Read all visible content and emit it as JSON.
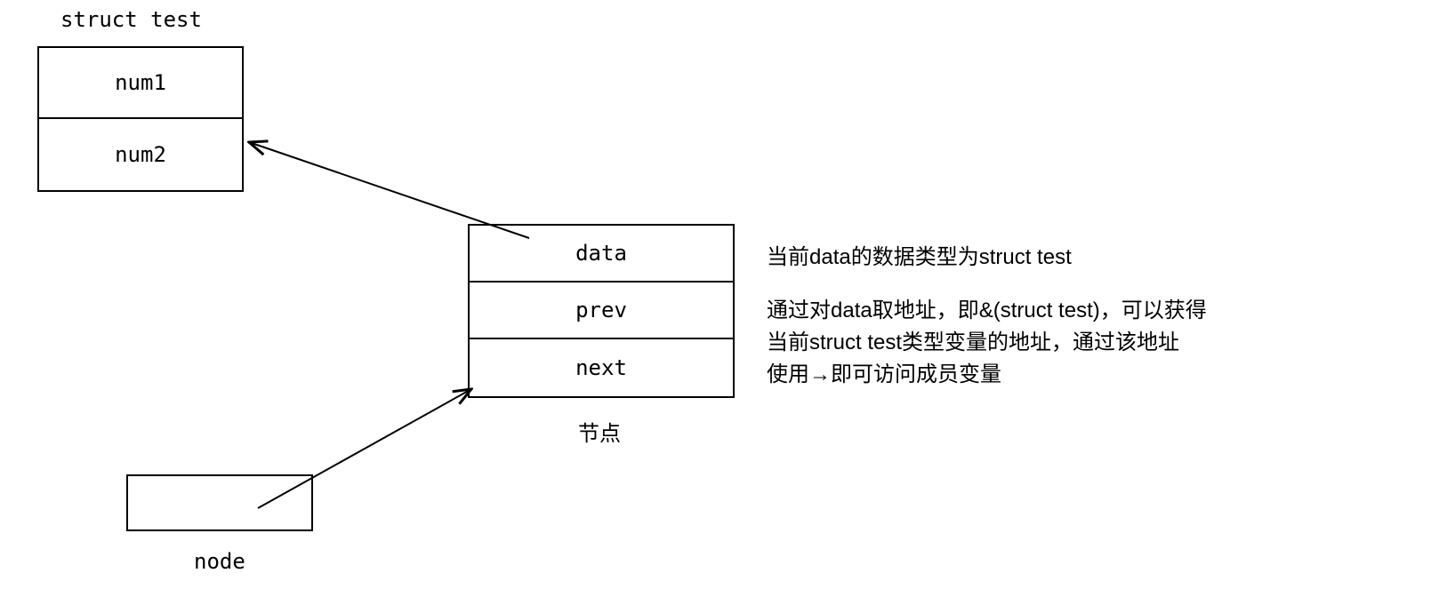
{
  "struct_label": "struct test",
  "struct_box": {
    "field1": "num1",
    "field2": "num2"
  },
  "node_struct": {
    "field1": "data",
    "field2": "prev",
    "field3": "next"
  },
  "node_struct_caption": "节点",
  "node_label": "node",
  "explanation": {
    "line1": "当前data的数据类型为struct test",
    "line2": "通过对data取地址，即&(struct test)，可以获得",
    "line3": "当前struct test类型变量的地址，通过该地址",
    "line4": "使用→即可访问成员变量"
  }
}
